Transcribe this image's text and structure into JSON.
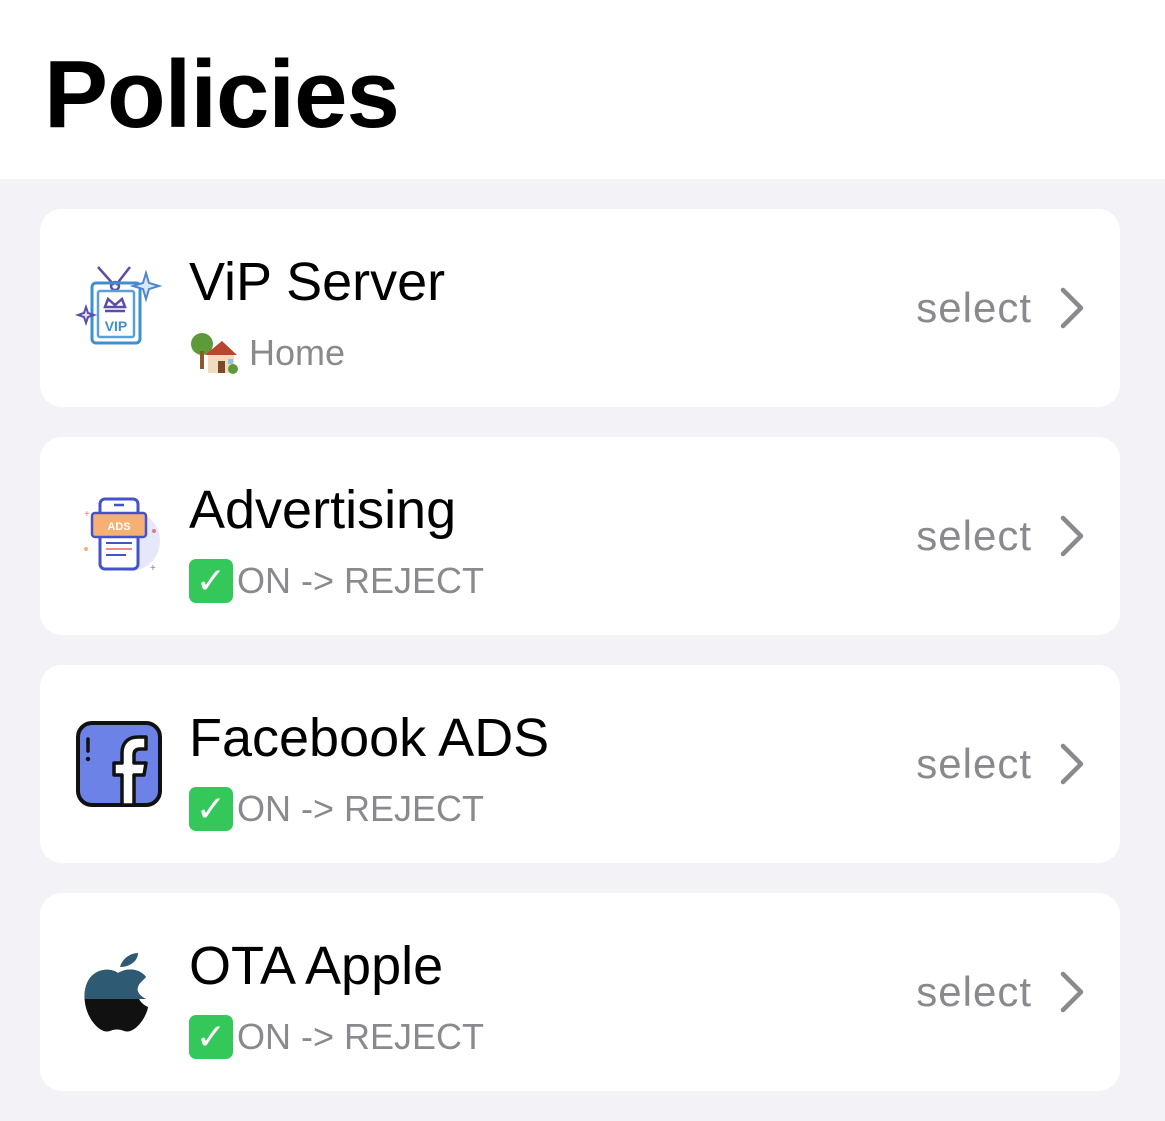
{
  "page": {
    "title": "Policies"
  },
  "policies": [
    {
      "name": "ViP Server",
      "subtitle": "Home",
      "subtitle_emoji": "house-with-garden-icon",
      "icon": "vip-ticket-icon",
      "action": "select"
    },
    {
      "name": "Advertising",
      "subtitle": "ON -> REJECT",
      "subtitle_emoji": "check-mark-button-icon",
      "icon": "ads-phone-icon",
      "action": "select"
    },
    {
      "name": "Facebook ADS",
      "subtitle": "ON -> REJECT",
      "subtitle_emoji": "check-mark-button-icon",
      "icon": "facebook-icon",
      "action": "select"
    },
    {
      "name": "OTA Apple",
      "subtitle": "ON -> REJECT",
      "subtitle_emoji": "check-mark-button-icon",
      "icon": "apple-logo-icon",
      "action": "select"
    }
  ],
  "colors": {
    "background": "#f2f2f7",
    "card": "#ffffff",
    "secondary_text": "#8a8a8e",
    "check_green": "#34c759",
    "facebook_blue": "#6d82e6"
  }
}
